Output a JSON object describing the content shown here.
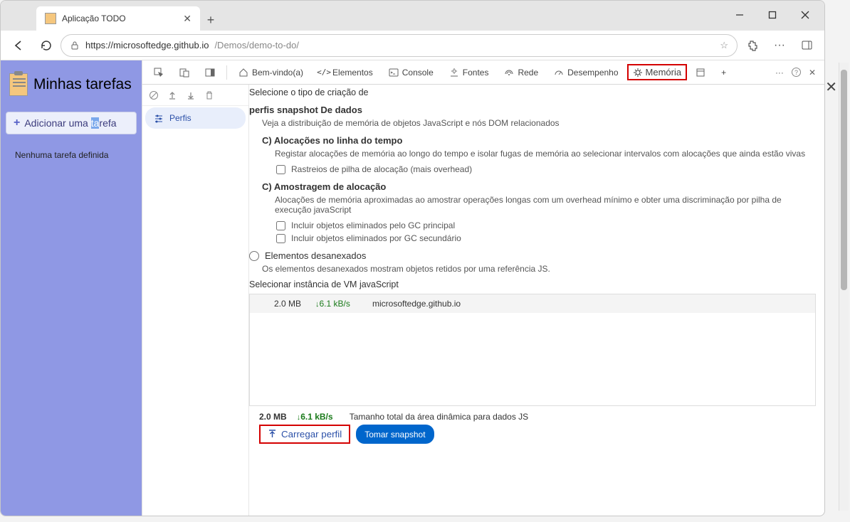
{
  "browser_tab": {
    "title": "Aplicação TODO"
  },
  "url": {
    "protocol_host": "https://microsoftedge.github.io",
    "path": "/Demos/demo-to-do/"
  },
  "app": {
    "title": "Minhas tarefas",
    "add_task": {
      "prefix": "Adicionar uma ",
      "hl": "ta",
      "suffix": "refa"
    },
    "no_task": "Nenhuma tarefa definida"
  },
  "devtools": {
    "tabs": {
      "welcome": "Bem-vindo(a)",
      "elements": "Elementos",
      "console": "Console",
      "sources": "Fontes",
      "network": "Rede",
      "performance": "Desempenho",
      "memory": "Memória"
    },
    "sidebar": {
      "profiles": "Perfis"
    },
    "memory": {
      "select_type": "Selecione o tipo de criação de",
      "heap_title": "perfis snapshot De dados",
      "heap_desc": "Veja a distribuição de memória de objetos JavaScript e nós DOM relacionados",
      "timeline_title": "C) Alocações no linha do tempo",
      "timeline_desc": "Registar alocações de memória ao longo do tempo e isolar fugas de memória ao selecionar intervalos com alocações que ainda estão vivas",
      "timeline_chk": "Rastreios de pilha de alocação (mais overhead)",
      "sampling_title": "C) Amostragem de alocação",
      "sampling_desc": "Alocações de memória aproximadas ao amostrar operações longas com um overhead mínimo e obter uma discriminação por pilha de execução javaScript",
      "sampling_chk1": "Incluir objetos eliminados pelo GC principal",
      "sampling_chk2": "Incluir objetos eliminados por GC secundário",
      "detached_title": "Elementos desanexados",
      "detached_desc": "Os elementos desanexados mostram objetos retidos por uma referência JS.",
      "vm_title": "Selecionar instância de VM javaScript",
      "vm_row": {
        "size": "2.0 MB",
        "rate": "6.1 kB/s",
        "host": "microsoftedge.github.io"
      },
      "footer": {
        "size": "2.0 MB",
        "rate": "6.1 kB/s",
        "heap_label": "Tamanho total da área dinâmica para dados JS"
      },
      "load_btn": "Carregar perfil",
      "snap_btn": "Tomar snapshot"
    }
  }
}
